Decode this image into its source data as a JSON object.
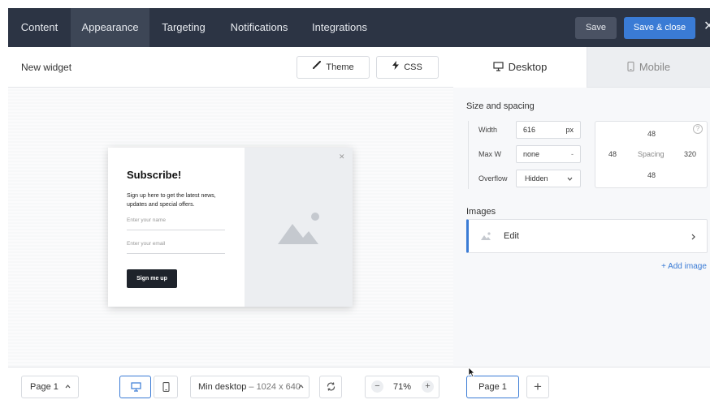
{
  "topbar": {
    "tabs": [
      "Content",
      "Appearance",
      "Targeting",
      "Notifications",
      "Integrations"
    ],
    "save_label": "Save",
    "save_close_label": "Save & close",
    "close_glyph": "✕"
  },
  "editor": {
    "title": "New widget",
    "theme_label": "Theme",
    "css_label": "CSS"
  },
  "popup": {
    "title": "Subscribe!",
    "text": "Sign up here to get the latest news, updates and special offers.",
    "name_placeholder": "Enter your name",
    "email_placeholder": "Enter your email",
    "button_label": "Sign me up",
    "close_glyph": "✕"
  },
  "bottom": {
    "page_select": "Page 1",
    "device_label": "Min desktop",
    "device_size": "1024 x 640",
    "zoom": "71%",
    "minus": "−",
    "plus": "+"
  },
  "panel": {
    "tab_desktop": "Desktop",
    "tab_mobile": "Mobile",
    "size_section": "Size and spacing",
    "width_label": "Width",
    "width_value": "616",
    "width_unit": "px",
    "maxw_label": "Max W",
    "maxw_value": "none",
    "maxw_dash": "-",
    "overflow_label": "Overflow",
    "overflow_value": "Hidden",
    "spacing_label": "Spacing",
    "spacing_top": "48",
    "spacing_left": "48",
    "spacing_right": "320",
    "spacing_bottom": "48",
    "help_glyph": "?",
    "images_section": "Images",
    "image_edit": "Edit",
    "add_image": "+ Add image",
    "page_tab": "Page 1",
    "add_page": "+"
  },
  "colors": {
    "topbar": "#2c3444",
    "accent": "#3a7bd5",
    "button_dark": "#1e232b"
  }
}
